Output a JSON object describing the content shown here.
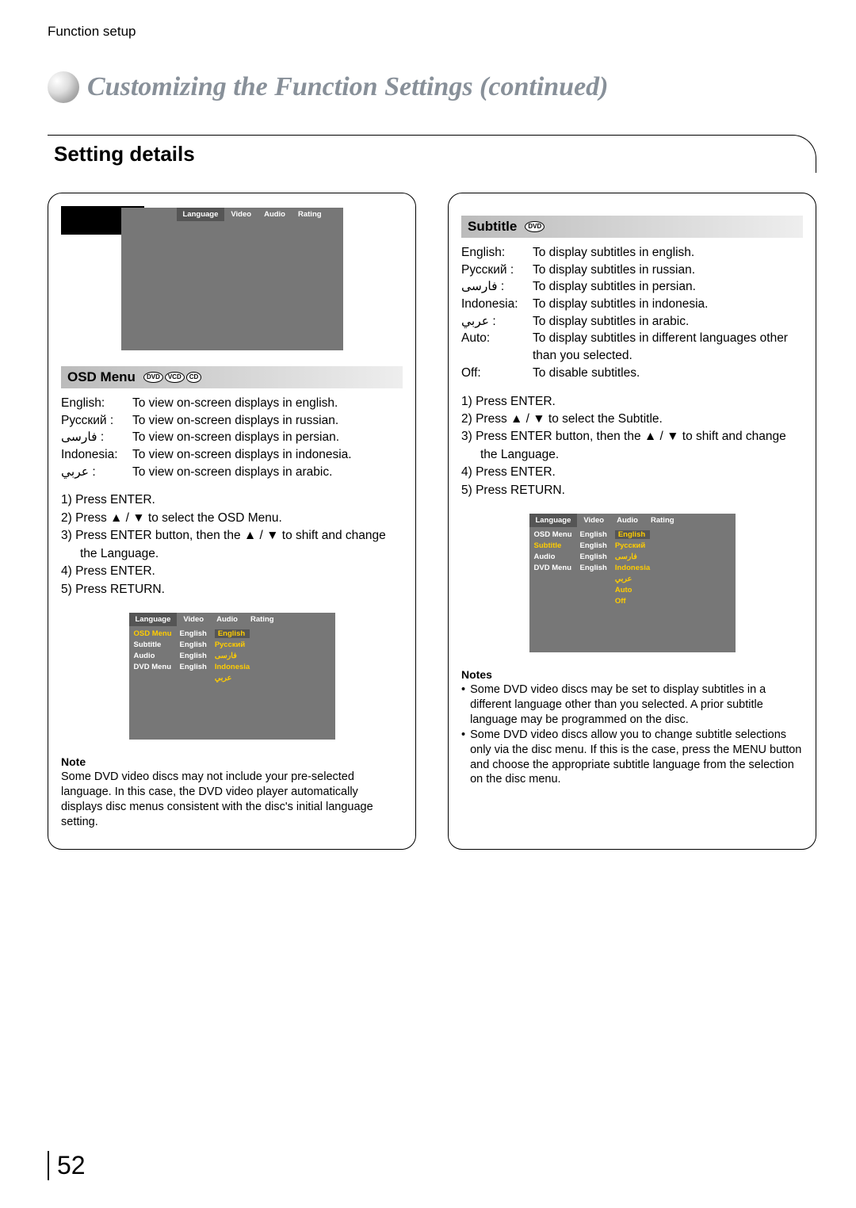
{
  "header": {
    "section": "Function setup",
    "title": "Customizing the Function Settings (continued)"
  },
  "section_heading": "Setting details",
  "osd_menu": {
    "heading": "OSD Menu",
    "discs": [
      "DVD",
      "VCD",
      "CD"
    ],
    "languages": [
      {
        "name": "English:",
        "desc": "To view on-screen displays in english."
      },
      {
        "name": "Русский :",
        "desc": "To view on-screen displays in russian."
      },
      {
        "name": "فارسی :",
        "desc": "To view on-screen displays in persian."
      },
      {
        "name": "Indonesia:",
        "desc": "To view on-screen displays in indonesia."
      },
      {
        "name": "عربي :",
        "desc": "To view on-screen displays in arabic."
      }
    ],
    "steps": [
      "1)  Press ENTER.",
      "2)  Press ▲ / ▼ to select the OSD Menu.",
      "3)  Press ENTER button, then the ▲ / ▼ to shift and change the Language.",
      "4)  Press ENTER.",
      "5)  Press RETURN."
    ],
    "note_heading": "Note",
    "note": "Some DVD video discs may not include your pre-selected language. In this case, the DVD video player automatically displays disc menus consistent with the disc's initial language setting."
  },
  "subtitle": {
    "heading": "Subtitle",
    "discs": [
      "DVD"
    ],
    "languages": [
      {
        "name": "English:",
        "desc": "To display subtitles in english."
      },
      {
        "name": "Русский :",
        "desc": "To display subtitles in russian."
      },
      {
        "name": "فارسی :",
        "desc": "To display subtitles in persian."
      },
      {
        "name": "Indonesia:",
        "desc": "To display subtitles in indonesia."
      },
      {
        "name": "عربي :",
        "desc": "To display subtitles in arabic."
      },
      {
        "name": "Auto:",
        "desc": "To display subtitles in different languages other than you selected."
      },
      {
        "name": "Off:",
        "desc": "To disable subtitles."
      }
    ],
    "steps": [
      "1)  Press ENTER.",
      "2)  Press ▲ / ▼ to select the Subtitle.",
      "3)  Press ENTER button, then the ▲ / ▼ to shift and change the Language.",
      "4)  Press ENTER.",
      "5)  Press RETURN."
    ],
    "notes_heading": "Notes",
    "notes": [
      "Some DVD video discs may be set to display subtitles in a different language other than you selected. A prior subtitle language may be programmed on the disc.",
      "Some DVD video discs allow you to change subtitle selections only via the disc menu. If this is the case, press the MENU button and choose the appropriate subtitle language from the selection on the disc menu."
    ]
  },
  "screen": {
    "tabs": [
      "Language",
      "Video",
      "Audio",
      "Rating"
    ],
    "col1": [
      "OSD Menu",
      "Subtitle",
      "Audio",
      "DVD Menu"
    ],
    "col2": [
      "English",
      "English",
      "English",
      "English"
    ],
    "col3_osd": [
      "English",
      "Русский",
      "فارسی",
      "Indonesia",
      "عربي"
    ],
    "col3_sub": [
      "English",
      "Русский",
      "فارسی",
      "Indonesia",
      "عربي",
      "Auto",
      "Off"
    ]
  },
  "page_number": "52"
}
